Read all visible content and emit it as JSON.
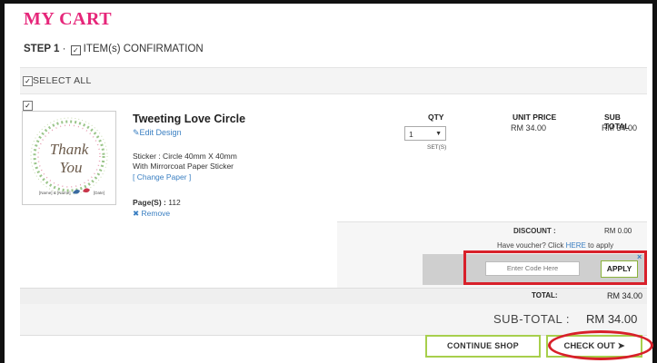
{
  "page": {
    "title": "MY CART"
  },
  "step": {
    "number": "STEP 1",
    "separator": "·",
    "label": "ITEM(s) CONFIRMATION"
  },
  "select_all": {
    "label": "SELECT ALL",
    "checked": true
  },
  "item": {
    "checked": true,
    "name": "Tweeting Love Circle",
    "edit_design": "Edit Design",
    "spec_line1": "Sticker : Circle 40mm X 40mm",
    "spec_line2": "With Mirrorcoat Paper Sticker",
    "change_paper": "[ Change Paper ]",
    "pages_label": "Page(S) :",
    "pages_value": "112",
    "remove": "Remove",
    "thumbnail": {
      "line1": "Thank",
      "line2": "You",
      "left_tag": "[Name] & [Name]",
      "right_tag": "[Date]"
    },
    "qty_header": "QTY",
    "qty_value": "1",
    "qty_unit": "SET(S)",
    "unit_price_header": "UNIT PRICE",
    "unit_price": "RM 34.00",
    "subtotal_header": "SUB TOTAL",
    "subtotal": "RM 34.00"
  },
  "discount": {
    "label": "DISCOUNT :",
    "value": "RM 0.00"
  },
  "voucher": {
    "prompt_before": "Have voucher? Click ",
    "link": "HERE",
    "prompt_after": " to apply",
    "placeholder": "Enter Code Here",
    "apply": "APPLY",
    "close": "×"
  },
  "total": {
    "label": "TOTAL:",
    "value": "RM 34.00"
  },
  "sub_total": {
    "label": "SUB-TOTAL :",
    "value": "RM 34.00"
  },
  "buttons": {
    "continue": "CONTINUE SHOP",
    "checkout": "CHECK OUT ➤"
  },
  "colors": {
    "brand_pink": "#e6267a",
    "link_blue": "#3a7fc2",
    "button_green": "#a7cf4c",
    "annotation_red": "#d8202a"
  },
  "icons": [
    "checkbox-icon",
    "edit-icon",
    "remove-x-icon",
    "dropdown-arrow-icon",
    "close-icon",
    "arrow-right-icon"
  ]
}
